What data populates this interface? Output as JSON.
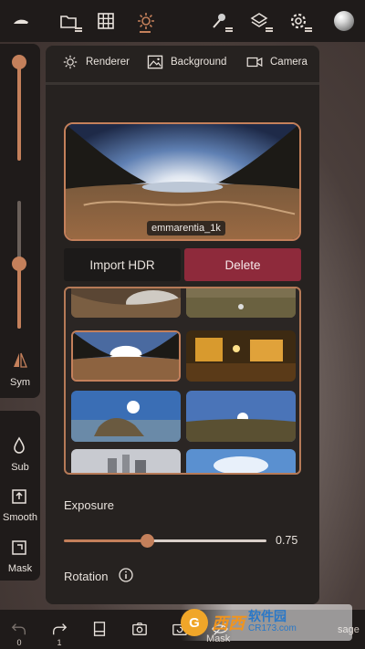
{
  "topbar": {
    "icons": [
      "sculpt-brush-icon",
      "folder-icon",
      "grid-icon",
      "sun-icon",
      "paint-icon",
      "layers-icon",
      "gear-icon",
      "matcap-icon"
    ]
  },
  "left_tools": {
    "sym_label": "Sym",
    "sub_label": "Sub",
    "smooth_label": "Smooth",
    "mask_label": "Mask"
  },
  "panel": {
    "tabs": [
      {
        "label": "Renderer",
        "icon": "sun-icon"
      },
      {
        "label": "Background",
        "icon": "image-icon"
      },
      {
        "label": "Camera",
        "icon": "camera-icon"
      }
    ],
    "hdr_name": "emmarentia_1k",
    "import_label": "Import HDR",
    "delete_label": "Delete",
    "exposure_label": "Exposure",
    "exposure_value": "0.75",
    "exposure_fraction": 0.4,
    "rotation_label": "Rotation"
  },
  "bottombar": {
    "undo_count": "0",
    "redo_count": "1",
    "mask_label": "Mask",
    "sage_label": "sage"
  },
  "watermark": {
    "logo": "G",
    "brand": "西西",
    "cn": "软件园",
    "url": "CR173.com"
  },
  "colors": {
    "accent": "#c4805b",
    "delete": "#8e2a3b",
    "panel": "#262220",
    "toolbar": "#1f1b1a"
  }
}
